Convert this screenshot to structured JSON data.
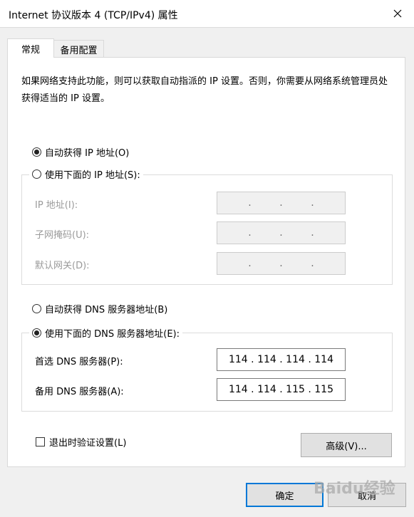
{
  "window": {
    "title": "Internet 协议版本 4 (TCP/IPv4) 属性",
    "close_glyph": "✕"
  },
  "tabs": [
    {
      "label": "常规",
      "active": true
    },
    {
      "label": "备用配置",
      "active": false
    }
  ],
  "description": "如果网络支持此功能，则可以获取自动指派的 IP 设置。否则，你需要从网络系统管理员处获得适当的 IP 设置。",
  "ip_section": {
    "auto_option": {
      "label": "自动获得 IP 地址(O)",
      "checked": true
    },
    "manual_option": {
      "label": "使用下面的 IP 地址(S):",
      "checked": false
    },
    "fields": [
      {
        "label": "IP 地址(I):",
        "value": ". . ."
      },
      {
        "label": "子网掩码(U):",
        "value": ". . ."
      },
      {
        "label": "默认网关(D):",
        "value": ". . ."
      }
    ]
  },
  "dns_section": {
    "auto_option": {
      "label": "自动获得 DNS 服务器地址(B)",
      "checked": false
    },
    "manual_option": {
      "label": "使用下面的 DNS 服务器地址(E):",
      "checked": true
    },
    "fields": [
      {
        "label": "首选 DNS 服务器(P):",
        "octets": [
          "114",
          "114",
          "114",
          "114"
        ]
      },
      {
        "label": "备用 DNS 服务器(A):",
        "octets": [
          "114",
          "114",
          "115",
          "115"
        ]
      }
    ]
  },
  "validate_checkbox": {
    "label": "退出时验证设置(L)",
    "checked": false
  },
  "buttons": {
    "advanced": "高级(V)...",
    "ok": "确定",
    "cancel": "取消"
  },
  "watermark": "Baidu经验",
  "colors": {
    "accent": "#0078d7",
    "panel": "#ffffff",
    "background": "#f0f0f0"
  }
}
